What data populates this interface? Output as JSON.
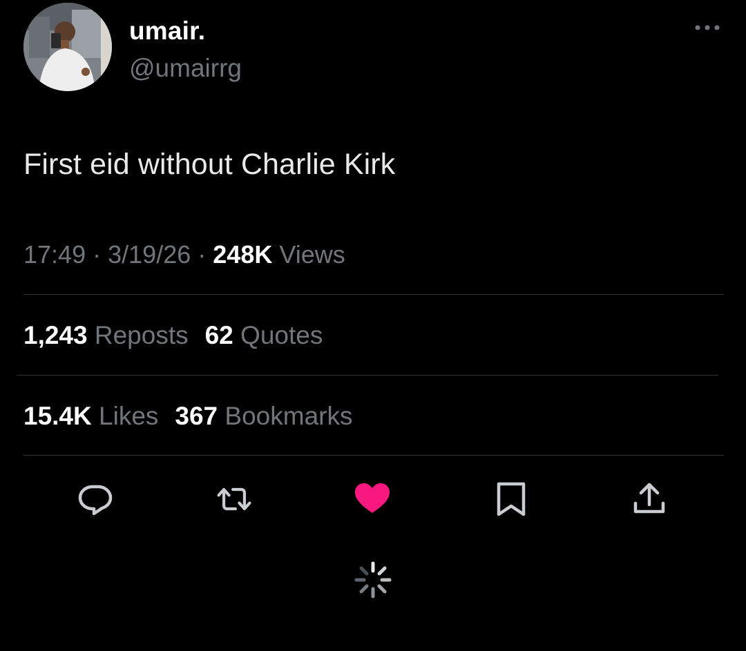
{
  "author": {
    "display_name": "umair.",
    "handle": "@umairrg"
  },
  "tweet": {
    "text": "First eid without Charlie Kirk"
  },
  "meta": {
    "time": "17:49",
    "separator": "·",
    "date": "3/19/26",
    "views_count": "248K",
    "views_label": "Views"
  },
  "stats": {
    "reposts_count": "1,243",
    "reposts_label": "Reposts",
    "quotes_count": "62",
    "quotes_label": "Quotes",
    "likes_count": "15.4K",
    "likes_label": "Likes",
    "bookmarks_count": "367",
    "bookmarks_label": "Bookmarks"
  },
  "actions": [
    {
      "icon": "reply-icon"
    },
    {
      "icon": "repost-icon"
    },
    {
      "icon": "heart-icon",
      "active": true
    },
    {
      "icon": "bookmark-icon"
    },
    {
      "icon": "share-icon"
    }
  ],
  "colors": {
    "background": "#000000",
    "text_primary": "#ffffff",
    "text_secondary": "#71767b",
    "divider": "#2f3336",
    "like_active": "#f91880"
  }
}
